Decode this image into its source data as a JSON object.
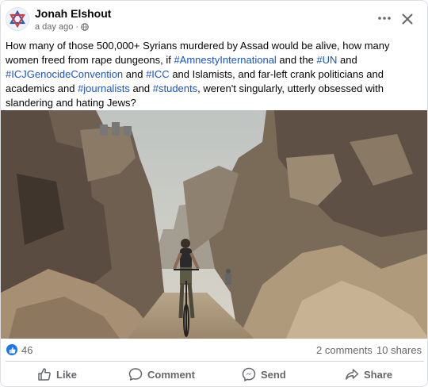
{
  "post": {
    "author": "Jonah Elshout",
    "timestamp": "a day ago",
    "separator": "·",
    "privacy_icon": "globe-icon",
    "avatar_icon": "star-of-david-icon",
    "text_segments": [
      {
        "type": "text",
        "value": "How many of those 500,000+ Syrians murdered by Assad would be alive, how many women freed from rape dungeons, if "
      },
      {
        "type": "hashtag",
        "value": "#AmnestyInternational"
      },
      {
        "type": "text",
        "value": " and the "
      },
      {
        "type": "hashtag",
        "value": "#UN"
      },
      {
        "type": "text",
        "value": " and "
      },
      {
        "type": "hashtag",
        "value": "#ICJGenocideConvention"
      },
      {
        "type": "text",
        "value": " and "
      },
      {
        "type": "hashtag",
        "value": "#ICC"
      },
      {
        "type": "text",
        "value": " and Islamists, and far-left crank politicians and academics and "
      },
      {
        "type": "hashtag",
        "value": "#journalists"
      },
      {
        "type": "text",
        "value": " and "
      },
      {
        "type": "hashtag",
        "value": "#students"
      },
      {
        "type": "text",
        "value": ", weren't singularly, utterly obsessed with slandering and hating Jews?"
      }
    ]
  },
  "stats": {
    "reactions": "46",
    "comments": "2 comments",
    "shares": "10 shares"
  },
  "actions": {
    "like": "Like",
    "comment": "Comment",
    "send": "Send",
    "share": "Share"
  },
  "colors": {
    "hashtag": "#1a55c9",
    "like_blue": "#1877f2",
    "muted": "#65676b"
  }
}
